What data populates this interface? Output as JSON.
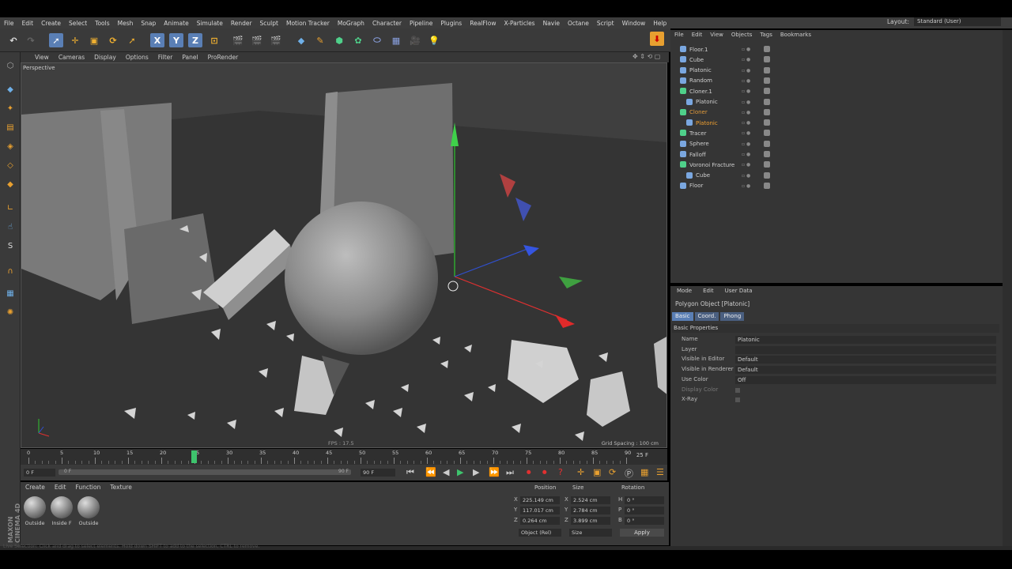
{
  "menubar": {
    "items": [
      "File",
      "Edit",
      "Create",
      "Select",
      "Tools",
      "Mesh",
      "Snap",
      "Animate",
      "Simulate",
      "Render",
      "Sculpt",
      "Motion Tracker",
      "MoGraph",
      "Character",
      "Pipeline",
      "Plugins",
      "RealFlow",
      "X-Particles",
      "Navie",
      "Octane",
      "Script",
      "Window",
      "Help"
    ],
    "layout_label": "Layout:",
    "layout_value": "Standard (User)"
  },
  "viewport_menu": {
    "items": [
      "View",
      "Cameras",
      "Display",
      "Options",
      "Filter",
      "Panel",
      "ProRender"
    ]
  },
  "viewport": {
    "camera_label": "Perspective",
    "fps": "FPS : 17.5",
    "grid_spacing": "Grid Spacing : 100 cm"
  },
  "timeline": {
    "ticks": [
      "0",
      "5",
      "10",
      "15",
      "20",
      "25",
      "30",
      "35",
      "40",
      "45",
      "50",
      "55",
      "60",
      "65",
      "70",
      "75",
      "80",
      "85",
      "90"
    ],
    "current_frame": "25 F",
    "current_frame_value": 25
  },
  "transport": {
    "start_field": "0 F",
    "end_field": "90 F",
    "range_end": "90 F",
    "range_start": "0 F"
  },
  "materials": {
    "menu": [
      "Create",
      "Edit",
      "Function",
      "Texture"
    ],
    "items": [
      "Outside",
      "Inside F",
      "Outside"
    ],
    "brand": "MAXON CINEMA 4D"
  },
  "coords": {
    "headers": [
      "Position",
      "Size",
      "Rotation"
    ],
    "rows": [
      {
        "axis": "X",
        "pos": "225.149 cm",
        "saxis": "X",
        "size": "2.524 cm",
        "raxis": "H",
        "rot": "0 °"
      },
      {
        "axis": "Y",
        "pos": "117.017 cm",
        "saxis": "Y",
        "size": "2.784 cm",
        "raxis": "P",
        "rot": "0 °"
      },
      {
        "axis": "Z",
        "pos": "0.264 cm",
        "saxis": "Z",
        "size": "3.899 cm",
        "raxis": "B",
        "rot": "0 °"
      }
    ],
    "mode_select": "Object (Rel)",
    "size_select": "Size",
    "apply": "Apply"
  },
  "object_manager": {
    "menu": [
      "File",
      "Edit",
      "View",
      "Objects",
      "Tags",
      "Bookmarks"
    ],
    "objects": [
      {
        "name": "Floor.1",
        "indent": 0,
        "color": "#cfcfcf",
        "icon": "#7aa7e0"
      },
      {
        "name": "Cube",
        "indent": 0,
        "color": "#cfcfcf",
        "icon": "#7aa7e0"
      },
      {
        "name": "Platonic",
        "indent": 0,
        "color": "#cfcfcf",
        "icon": "#7aa7e0"
      },
      {
        "name": "Random",
        "indent": 0,
        "color": "#cfcfcf",
        "icon": "#7aa7e0"
      },
      {
        "name": "Cloner.1",
        "indent": 0,
        "color": "#cfcfcf",
        "icon": "#4fd08a"
      },
      {
        "name": "Platonic",
        "indent": 1,
        "color": "#cfcfcf",
        "icon": "#7aa7e0"
      },
      {
        "name": "Cloner",
        "indent": 0,
        "color": "#e09a3a",
        "icon": "#4fd08a"
      },
      {
        "name": "Platonic",
        "indent": 1,
        "color": "#f0a030",
        "icon": "#7aa7e0"
      },
      {
        "name": "Tracer",
        "indent": 0,
        "color": "#cfcfcf",
        "icon": "#4fd08a"
      },
      {
        "name": "Sphere",
        "indent": 0,
        "color": "#cfcfcf",
        "icon": "#7aa7e0"
      },
      {
        "name": "Falloff",
        "indent": 0,
        "color": "#cfcfcf",
        "icon": "#7aa7e0"
      },
      {
        "name": "Voronoi Fracture",
        "indent": 0,
        "color": "#cfcfcf",
        "icon": "#4fd08a"
      },
      {
        "name": "Cube",
        "indent": 1,
        "color": "#cfcfcf",
        "icon": "#7aa7e0"
      },
      {
        "name": "Floor",
        "indent": 0,
        "color": "#cfcfcf",
        "icon": "#7aa7e0"
      }
    ]
  },
  "attribute_manager": {
    "menu": [
      "Mode",
      "Edit",
      "User Data"
    ],
    "title": "Polygon Object [Platonic]",
    "tabs": [
      "Basic",
      "Coord.",
      "Phong"
    ],
    "section": "Basic Properties",
    "fields": [
      {
        "label": "Name",
        "value": "Platonic"
      },
      {
        "label": "Layer",
        "value": ""
      },
      {
        "label": "Visible in Editor",
        "value": "Default"
      },
      {
        "label": "Visible in Renderer",
        "value": "Default"
      },
      {
        "label": "Use Color",
        "value": "Off"
      },
      {
        "label": "Display Color",
        "value": ""
      },
      {
        "label": "X-Ray",
        "value": ""
      }
    ]
  },
  "statusbar": {
    "text": "Live Selection: Click and drag to select elements. Hold down SHIFT to add to the selection, CTRL to remove."
  },
  "colors": {
    "accent": "#e09a3a",
    "selected_tab": "#5a7fb5",
    "keyframe": "#3ec46d"
  }
}
